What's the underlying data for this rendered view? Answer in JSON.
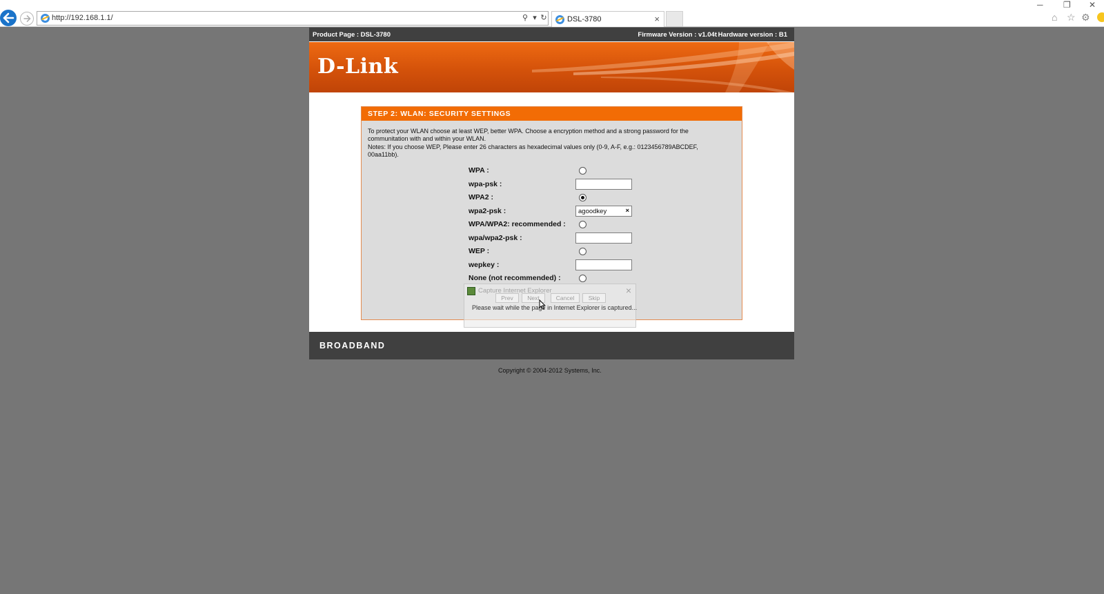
{
  "browser": {
    "url": "http://192.168.1.1/",
    "tab_title": "DSL-3780",
    "tab_close": "×",
    "window_min": "─",
    "window_restore": "❐",
    "window_close": "✕",
    "search_glyph": "⚲",
    "dropdown_glyph": "▾",
    "refresh_glyph": "↻",
    "home_glyph": "⌂",
    "favorites_glyph": "☆",
    "tools_glyph": "⚙",
    "accent_color": "#1a73c9"
  },
  "header": {
    "product": "Product Page : DSL-3780",
    "firmware": "Firmware Version : v1.04t",
    "hardware": "Hardware version : B1"
  },
  "banner": {
    "logo": "D-Link",
    "brand_color": "#f26c05"
  },
  "panel": {
    "title": "STEP 2: WLAN: SECURITY SETTINGS",
    "desc_line1": "To protect your WLAN choose at least WEP, better WPA. Choose a encryption method and a strong password for the",
    "desc_line2": "communitation with and within your WLAN.",
    "desc_line3": "Notes: If you choose WEP, Please enter 26 characters as hexadecimal values only (0-9, A-F, e.g.: 0123456789ABCDEF,",
    "desc_line4": "00aa11bb).",
    "rows": [
      {
        "label": "WPA :",
        "control": "radio",
        "checked": false
      },
      {
        "label": "wpa-psk :",
        "control": "text",
        "value": ""
      },
      {
        "label": "WPA2 :",
        "control": "radio",
        "checked": true
      },
      {
        "label": "wpa2-psk :",
        "control": "text",
        "value": "agoodkey"
      },
      {
        "label": "WPA/WPA2: recommended :",
        "control": "radio",
        "checked": false
      },
      {
        "label": "wpa/wpa2-psk :",
        "control": "text",
        "value": ""
      },
      {
        "label": "WEP :",
        "control": "radio",
        "checked": false
      },
      {
        "label": "wepkey :",
        "control": "text",
        "value": ""
      },
      {
        "label": "None (not recommended) :",
        "control": "radio",
        "checked": false
      }
    ],
    "clear_glyph": "×"
  },
  "capture_dialog": {
    "title": "Capture Internet Explorer",
    "prev": "Prev",
    "next": "Next",
    "cancel": "Cancel",
    "skip": "Skip",
    "close": "×",
    "message": "Please wait while the page in Internet Explorer is captured..."
  },
  "footer": {
    "brand": "BROADBAND",
    "copyright": "Copyright © 2004-2012 Systems, Inc."
  }
}
